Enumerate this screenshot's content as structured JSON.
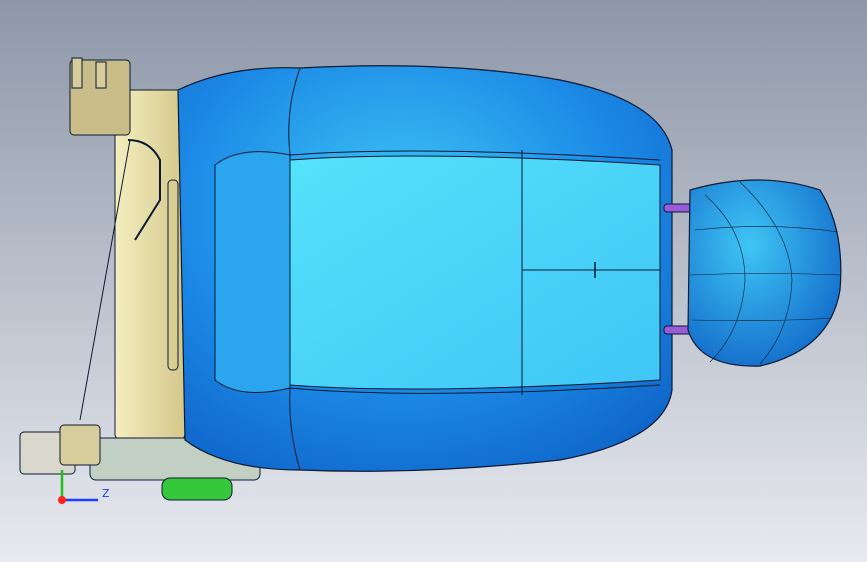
{
  "viewport": {
    "background_top": "#8d97a8",
    "background_bottom": "#e8eaf0"
  },
  "colors": {
    "cushion_dark": "#0d5fc4",
    "cushion_mid": "#1c8ae6",
    "cushion_light": "#3fc6f5",
    "insert_light": "#56e1fb",
    "frame": "#f4eebf",
    "frame_shadow": "#d4c78a",
    "mechanism": "#c8bc88",
    "housing": "#c2cfc3",
    "foot_green": "#34c83a",
    "rod_purple": "#9b5bd8",
    "edge": "#0b1a33"
  },
  "triad": {
    "z_label": "Z",
    "x_color": "#ff2020",
    "y_color": "#1fbf1f",
    "z_color": "#1f3fff"
  }
}
